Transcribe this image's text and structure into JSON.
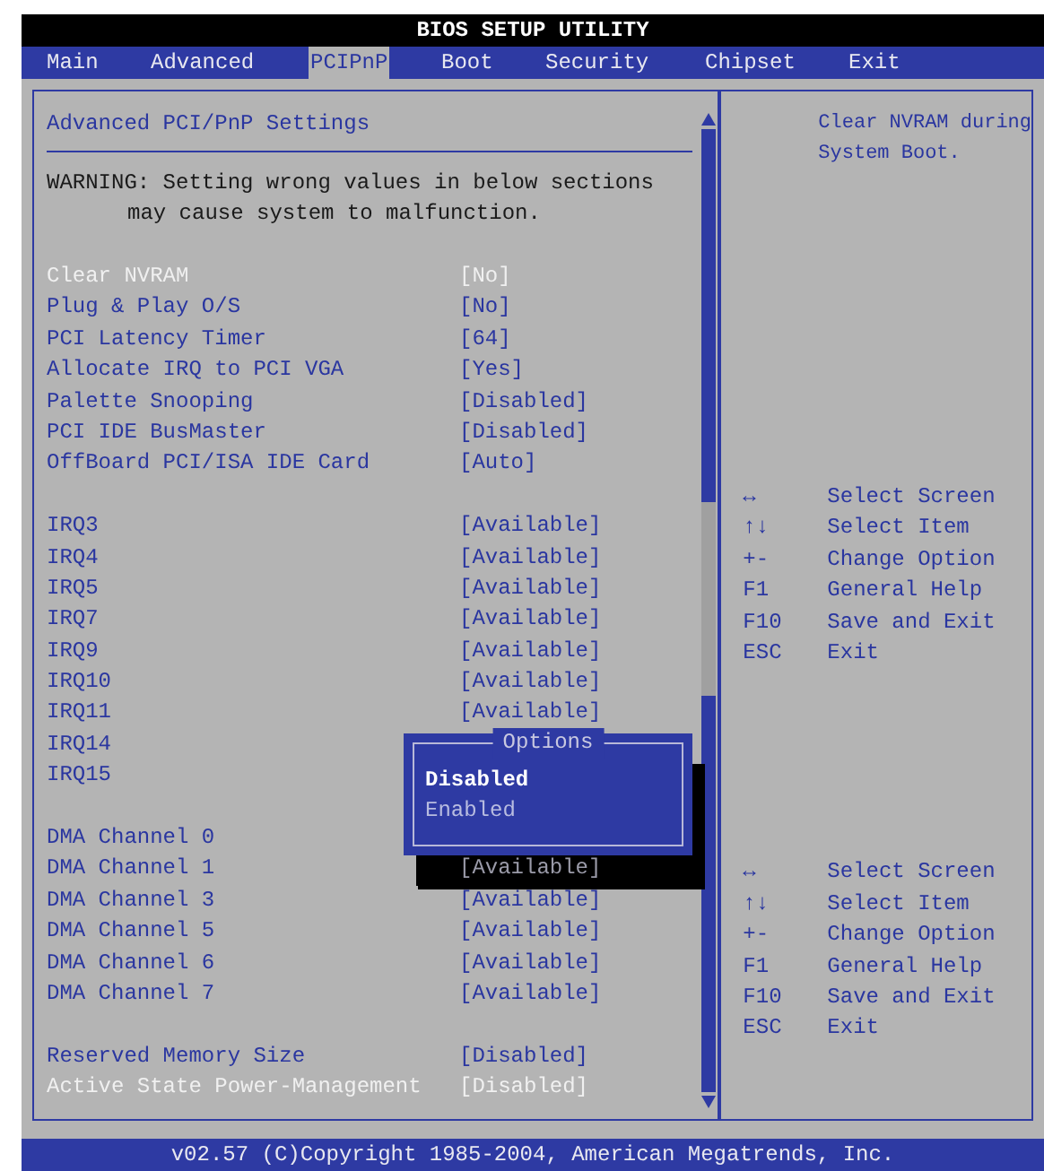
{
  "window": {
    "title": "BIOS SETUP UTILITY"
  },
  "tabs": [
    {
      "label": "Main",
      "selected": false
    },
    {
      "label": "Advanced",
      "selected": false
    },
    {
      "label": "PCIPnP",
      "selected": true
    },
    {
      "label": "Boot",
      "selected": false
    },
    {
      "label": "Security",
      "selected": false
    },
    {
      "label": "Chipset",
      "selected": false
    },
    {
      "label": "Exit",
      "selected": false
    }
  ],
  "panel": {
    "heading": "Advanced PCI/PnP Settings",
    "warning": [
      "WARNING: Setting wrong values in below sections",
      "may cause system to malfunction."
    ]
  },
  "settings": [
    {
      "kind": "setting",
      "label": "Clear NVRAM",
      "value": "[No]",
      "highlighted": true
    },
    {
      "kind": "setting",
      "label": "Plug & Play O/S",
      "value": "[No]",
      "highlighted": false
    },
    {
      "kind": "setting",
      "label": "PCI Latency Timer",
      "value": "[64]",
      "highlighted": false
    },
    {
      "kind": "setting",
      "label": "Allocate IRQ to PCI VGA",
      "value": "[Yes]",
      "highlighted": false
    },
    {
      "kind": "setting",
      "label": "Palette Snooping",
      "value": "[Disabled]",
      "highlighted": false
    },
    {
      "kind": "setting",
      "label": "PCI IDE BusMaster",
      "value": "[Disabled]",
      "highlighted": false
    },
    {
      "kind": "setting",
      "label": "OffBoard PCI/ISA IDE Card",
      "value": "[Auto]",
      "highlighted": false
    },
    {
      "kind": "gap"
    },
    {
      "kind": "setting",
      "label": "IRQ3",
      "value": "[Available]",
      "highlighted": false
    },
    {
      "kind": "setting",
      "label": "IRQ4",
      "value": "[Available]",
      "highlighted": false
    },
    {
      "kind": "setting",
      "label": "IRQ5",
      "value": "[Available]",
      "highlighted": false
    },
    {
      "kind": "setting",
      "label": "IRQ7",
      "value": "[Available]",
      "highlighted": false
    },
    {
      "kind": "setting",
      "label": "IRQ9",
      "value": "[Available]",
      "highlighted": false
    },
    {
      "kind": "setting",
      "label": "IRQ10",
      "value": "[Available]",
      "highlighted": false
    },
    {
      "kind": "setting",
      "label": "IRQ11",
      "value": "[Available]",
      "highlighted": false
    },
    {
      "kind": "setting",
      "label": "IRQ14",
      "highlighted": false
    },
    {
      "kind": "setting",
      "label": "IRQ15",
      "highlighted": false
    },
    {
      "kind": "gap"
    },
    {
      "kind": "setting",
      "label": "DMA Channel 0",
      "highlighted": false
    },
    {
      "kind": "setting",
      "label": "DMA Channel 1",
      "value": "[Available]",
      "highlighted": false,
      "shadowed": true
    },
    {
      "kind": "setting",
      "label": "DMA Channel 3",
      "value": "[Available]",
      "highlighted": false
    },
    {
      "kind": "setting",
      "label": "DMA Channel 5",
      "value": "[Available]",
      "highlighted": false
    },
    {
      "kind": "setting",
      "label": "DMA Channel 6",
      "value": "[Available]",
      "highlighted": false
    },
    {
      "kind": "setting",
      "label": "DMA Channel 7",
      "value": "[Available]",
      "highlighted": false
    },
    {
      "kind": "gap"
    },
    {
      "kind": "setting",
      "label": "Reserved Memory Size",
      "value": "[Disabled]",
      "highlighted": false
    },
    {
      "kind": "setting",
      "label": "Active State Power-Management",
      "value": "[Disabled]",
      "highlighted": true
    }
  ],
  "popup": {
    "title": "Options",
    "options": [
      {
        "label": "Disabled",
        "selected": true
      },
      {
        "label": "Enabled",
        "selected": false
      }
    ]
  },
  "help_text": [
    "Clear NVRAM during",
    "System Boot."
  ],
  "key_legends": [
    [
      {
        "key": "↔",
        "action": "Select Screen"
      },
      {
        "key": "↑↓",
        "action": "Select Item"
      },
      {
        "key": "+-",
        "action": "Change Option"
      },
      {
        "key": "F1",
        "action": "General Help"
      },
      {
        "key": "F10",
        "action": "Save and Exit"
      },
      {
        "key": "ESC",
        "action": "Exit"
      }
    ],
    [
      {
        "key": "↔",
        "action": "Select Screen"
      },
      {
        "key": "↑↓",
        "action": "Select Item"
      },
      {
        "key": "+-",
        "action": "Change Option"
      },
      {
        "key": "F1",
        "action": "General Help"
      },
      {
        "key": "F10",
        "action": "Save and Exit"
      },
      {
        "key": "ESC",
        "action": "Exit"
      }
    ]
  ],
  "status_bar": "v02.57 (C)Copyright 1985-2004, American Megatrends, Inc."
}
